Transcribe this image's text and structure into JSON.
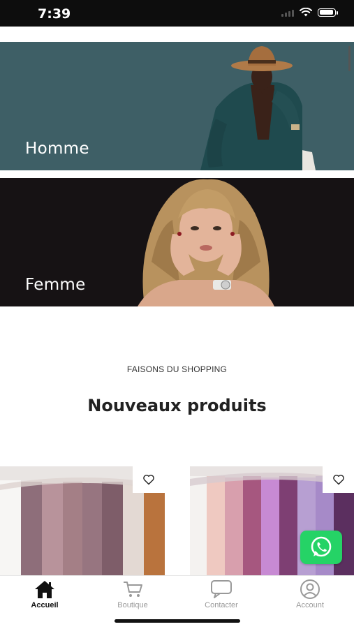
{
  "status": {
    "time": "7:39"
  },
  "categories": [
    {
      "label": "Homme",
      "bg": "#3e5f66"
    },
    {
      "label": "Femme",
      "bg": "#161214"
    }
  ],
  "section": {
    "eyebrow": "FAISONS DU SHOPPING",
    "title": "Nouveaux produits"
  },
  "products": [
    {
      "favorite": false
    },
    {
      "favorite": false
    }
  ],
  "tabs": [
    {
      "label": "Accueil",
      "icon": "home-icon",
      "active": true
    },
    {
      "label": "Boutique",
      "icon": "cart-icon",
      "active": false
    },
    {
      "label": "Contacter",
      "icon": "chat-bubble-icon",
      "active": false
    },
    {
      "label": "Account",
      "icon": "user-icon",
      "active": false
    }
  ],
  "colors": {
    "accent": "#111111",
    "whatsapp": "#25d366",
    "homme_bg": "#3e5f66",
    "femme_bg": "#161214"
  }
}
